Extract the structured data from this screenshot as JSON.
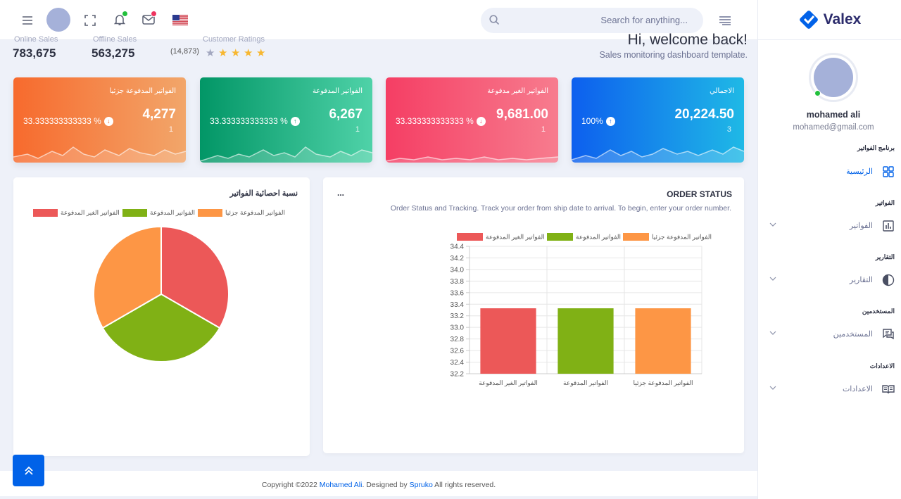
{
  "header": {
    "search_placeholder": "Search for anything...",
    "icons": [
      "menu-icon",
      "fullscreen-icon",
      "bell-icon",
      "mail-icon",
      "flag-us-icon",
      "list-icon"
    ]
  },
  "stats": {
    "online_sales_label": "Online Sales",
    "online_sales_value": "783,675",
    "offline_sales_label": "Offline Sales",
    "offline_sales_value": "563,275",
    "ratings_label": "Customer Ratings",
    "ratings_count": "(14,873)",
    "rating_stars": 4
  },
  "welcome": {
    "title": "Hi, welcome back!",
    "subtitle": "Sales monitoring dashboard template."
  },
  "cards": [
    {
      "title": "الفواتير المدفوعة جزئيا",
      "value": "4,277",
      "count": "1",
      "pct": "33.333333333333 %",
      "direction": "down",
      "color_from": "#f76a2d",
      "color_to": "#f2a66a"
    },
    {
      "title": "الفواتير المدفوعة",
      "value": "6,267",
      "count": "1",
      "pct": "33.333333333333 %",
      "direction": "up",
      "color_from": "#029666",
      "color_to": "#4fd2a8"
    },
    {
      "title": "الفواتير الغير مدفوعة",
      "value": "9,681.00",
      "count": "1",
      "pct": "33.333333333333 %",
      "direction": "down",
      "color_from": "#f53e64",
      "color_to": "#f77c8e"
    },
    {
      "title": "الاجمالي",
      "value": "20,224.50",
      "count": "3",
      "pct": "100%",
      "direction": "up",
      "color_from": "#0d5fee",
      "color_to": "#1fb9e6"
    }
  ],
  "pie_panel": {
    "title": "نسبة احصائية الفواتير",
    "legend": [
      {
        "label": "الفواتير المدفوعة جزئيا",
        "color": "#fd9645"
      },
      {
        "label": "الفواتير المدفوعة",
        "color": "#80b115"
      },
      {
        "label": "الفواتير الغير المدفوعة",
        "color": "#ec5858"
      }
    ]
  },
  "order_panel": {
    "title": "ORDER STATUS",
    "menu": "...",
    "subtitle": "Order Status and Tracking. Track your order from ship date to arrival. To begin, enter your order number."
  },
  "chart_data": [
    {
      "type": "pie",
      "categories": [
        "الفواتير الغير المدفوعة",
        "الفواتير المدفوعة",
        "الفواتير المدفوعة جزئيا"
      ],
      "values": [
        33.33,
        33.33,
        33.33
      ],
      "colors": [
        "#ec5858",
        "#80b115",
        "#fd9645"
      ]
    },
    {
      "type": "bar",
      "categories": [
        "الفواتير الغير المدفوعة",
        "الفواتير المدفوعة",
        "الفواتير المدفوعة جزئيا"
      ],
      "values": [
        33.33,
        33.33,
        33.33
      ],
      "colors": [
        "#ec5858",
        "#80b115",
        "#fd9645"
      ],
      "ylim": [
        32.2,
        34.4
      ],
      "yticks": [
        "34.4",
        "34.2",
        "34.0",
        "33.8",
        "33.6",
        "33.4",
        "33.2",
        "33.0",
        "32.8",
        "32.6",
        "32.4",
        "32.2"
      ],
      "legend": [
        "الفواتير الغير المدفوعة",
        "الفواتير المدفوعة",
        "الفواتير المدفوعة جزئيا"
      ],
      "grid": true,
      "legend_position": "top"
    }
  ],
  "sidebar": {
    "logo": "Valex",
    "user_name": "mohamed ali",
    "user_email": "mohamed@gmail.com",
    "sections": [
      {
        "category": "برنامج الفواتير",
        "item": "الرئيسية",
        "icon": "dashboard-icon",
        "active": true
      },
      {
        "category": "الفواتير",
        "item": "الفواتير",
        "icon": "chart-icon",
        "active": false
      },
      {
        "category": "التقارير",
        "item": "التقارير",
        "icon": "pie-icon",
        "active": false
      },
      {
        "category": "المستخدمين",
        "item": "المستخدمين",
        "icon": "chat-icon",
        "active": false
      },
      {
        "category": "الاعدادات",
        "item": "الاعدادات",
        "icon": "book-icon",
        "active": false
      }
    ]
  },
  "footer": {
    "prefix": "Copyright ©2022 ",
    "author": "Mohamed Ali",
    "mid": ". Designed by ",
    "designer": "Spruko",
    "suffix": " All rights reserved."
  }
}
